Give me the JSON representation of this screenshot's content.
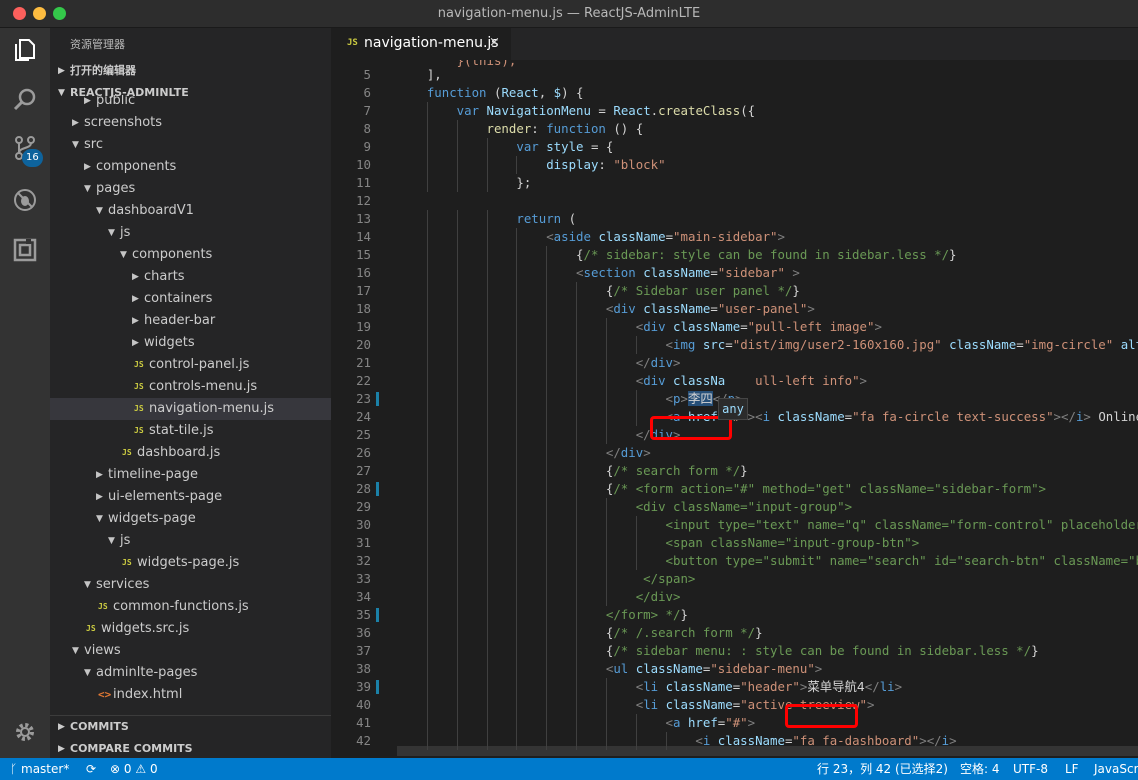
{
  "window": {
    "title": "navigation-menu.js — ReactJS-AdminLTE"
  },
  "activity_bar": {
    "items": [
      {
        "name": "explorer-icon"
      },
      {
        "name": "search-icon"
      },
      {
        "name": "source-control-icon"
      },
      {
        "name": "debug-icon"
      },
      {
        "name": "extensions-icon"
      }
    ],
    "scm_badge": "16"
  },
  "sidebar": {
    "title": "资源管理器",
    "open_editors": "打开的编辑器",
    "project": "REACTJS-ADMINLTE",
    "tree": [
      {
        "label": "public",
        "depth": 2,
        "kind": "folder",
        "expanded": false,
        "partial": true
      },
      {
        "label": "screenshots",
        "depth": 1,
        "kind": "folder",
        "expanded": false
      },
      {
        "label": "src",
        "depth": 1,
        "kind": "folder",
        "expanded": true
      },
      {
        "label": "components",
        "depth": 2,
        "kind": "folder",
        "expanded": false
      },
      {
        "label": "pages",
        "depth": 2,
        "kind": "folder",
        "expanded": true
      },
      {
        "label": "dashboardV1",
        "depth": 3,
        "kind": "folder",
        "expanded": true
      },
      {
        "label": "js",
        "depth": 4,
        "kind": "folder",
        "expanded": true
      },
      {
        "label": "components",
        "depth": 5,
        "kind": "folder",
        "expanded": true
      },
      {
        "label": "charts",
        "depth": 6,
        "kind": "folder",
        "expanded": false
      },
      {
        "label": "containers",
        "depth": 6,
        "kind": "folder",
        "expanded": false
      },
      {
        "label": "header-bar",
        "depth": 6,
        "kind": "folder",
        "expanded": false
      },
      {
        "label": "widgets",
        "depth": 6,
        "kind": "folder",
        "expanded": false
      },
      {
        "label": "control-panel.js",
        "depth": 6,
        "kind": "js"
      },
      {
        "label": "controls-menu.js",
        "depth": 6,
        "kind": "js"
      },
      {
        "label": "navigation-menu.js",
        "depth": 6,
        "kind": "js",
        "selected": true
      },
      {
        "label": "stat-tile.js",
        "depth": 6,
        "kind": "js"
      },
      {
        "label": "dashboard.js",
        "depth": 5,
        "kind": "js"
      },
      {
        "label": "timeline-page",
        "depth": 3,
        "kind": "folder",
        "expanded": false
      },
      {
        "label": "ui-elements-page",
        "depth": 3,
        "kind": "folder",
        "expanded": false
      },
      {
        "label": "widgets-page",
        "depth": 3,
        "kind": "folder",
        "expanded": true
      },
      {
        "label": "js",
        "depth": 4,
        "kind": "folder",
        "expanded": true
      },
      {
        "label": "widgets-page.js",
        "depth": 5,
        "kind": "js"
      },
      {
        "label": "services",
        "depth": 2,
        "kind": "folder",
        "expanded": true
      },
      {
        "label": "common-functions.js",
        "depth": 3,
        "kind": "js"
      },
      {
        "label": "widgets.src.js",
        "depth": 2,
        "kind": "js"
      },
      {
        "label": "views",
        "depth": 1,
        "kind": "folder",
        "expanded": true
      },
      {
        "label": "adminlte-pages",
        "depth": 2,
        "kind": "folder",
        "expanded": true
      },
      {
        "label": "index.html",
        "depth": 3,
        "kind": "html"
      }
    ],
    "sections": [
      {
        "label": "COMMITS"
      },
      {
        "label": "COMPARE COMMITS"
      }
    ],
    "icon_labels": {
      "js": "JS",
      "html": "<>"
    }
  },
  "editor": {
    "tab": {
      "label": "navigation-menu.js",
      "icon": "JS",
      "close": "×"
    },
    "tooltip": "any",
    "lines": [
      {
        "n": 5,
        "indent": 1,
        "modified": false,
        "parts": [
          [
            "p",
            "],"
          ]
        ]
      },
      {
        "n": 6,
        "indent": 1,
        "modified": false,
        "parts": [
          [
            "k",
            "function"
          ],
          [
            "p",
            " ("
          ],
          [
            "a",
            "React"
          ],
          [
            "p",
            ", "
          ],
          [
            "a",
            "$"
          ],
          [
            "p",
            ") {"
          ]
        ]
      },
      {
        "n": 7,
        "indent": 2,
        "modified": false,
        "parts": [
          [
            "k",
            "var"
          ],
          [
            "p",
            " "
          ],
          [
            "a",
            "NavigationMenu"
          ],
          [
            "p",
            " = "
          ],
          [
            "a",
            "React"
          ],
          [
            "p",
            "."
          ],
          [
            "f",
            "createClass"
          ],
          [
            "p",
            "({"
          ]
        ]
      },
      {
        "n": 8,
        "indent": 3,
        "modified": false,
        "parts": [
          [
            "f",
            "render"
          ],
          [
            "p",
            ": "
          ],
          [
            "k",
            "function"
          ],
          [
            "p",
            " () {"
          ]
        ]
      },
      {
        "n": 9,
        "indent": 4,
        "modified": false,
        "parts": [
          [
            "k",
            "var"
          ],
          [
            "p",
            " "
          ],
          [
            "a",
            "style"
          ],
          [
            "p",
            " = {"
          ]
        ]
      },
      {
        "n": 10,
        "indent": 5,
        "modified": false,
        "parts": [
          [
            "a",
            "display"
          ],
          [
            "p",
            ": "
          ],
          [
            "s",
            "\"block\""
          ]
        ]
      },
      {
        "n": 11,
        "indent": 4,
        "modified": false,
        "parts": [
          [
            "p",
            "};"
          ]
        ]
      },
      {
        "n": 12,
        "indent": 0,
        "modified": false,
        "parts": []
      },
      {
        "n": 13,
        "indent": 4,
        "modified": false,
        "parts": [
          [
            "k",
            "return"
          ],
          [
            "p",
            " ("
          ]
        ]
      },
      {
        "n": 14,
        "indent": 5,
        "modified": false,
        "parts": [
          [
            "g",
            "<"
          ],
          [
            "t",
            "aside"
          ],
          [
            "p",
            " "
          ],
          [
            "a",
            "className"
          ],
          [
            "p",
            "="
          ],
          [
            "s",
            "\"main-sidebar\""
          ],
          [
            "g",
            ">"
          ]
        ]
      },
      {
        "n": 15,
        "indent": 6,
        "modified": false,
        "parts": [
          [
            "p",
            "{"
          ],
          [
            "c",
            "/* sidebar: style can be found in sidebar.less */"
          ],
          [
            "p",
            "}"
          ]
        ]
      },
      {
        "n": 16,
        "indent": 6,
        "modified": false,
        "parts": [
          [
            "g",
            "<"
          ],
          [
            "t",
            "section"
          ],
          [
            "p",
            " "
          ],
          [
            "a",
            "className"
          ],
          [
            "p",
            "="
          ],
          [
            "s",
            "\"sidebar\""
          ],
          [
            "p",
            " "
          ],
          [
            "g",
            ">"
          ]
        ]
      },
      {
        "n": 17,
        "indent": 7,
        "modified": false,
        "parts": [
          [
            "p",
            "{"
          ],
          [
            "c",
            "/* Sidebar user panel */"
          ],
          [
            "p",
            "}"
          ]
        ]
      },
      {
        "n": 18,
        "indent": 7,
        "modified": false,
        "parts": [
          [
            "g",
            "<"
          ],
          [
            "t",
            "div"
          ],
          [
            "p",
            " "
          ],
          [
            "a",
            "className"
          ],
          [
            "p",
            "="
          ],
          [
            "s",
            "\"user-panel\""
          ],
          [
            "g",
            ">"
          ]
        ]
      },
      {
        "n": 19,
        "indent": 8,
        "modified": false,
        "parts": [
          [
            "g",
            "<"
          ],
          [
            "t",
            "div"
          ],
          [
            "p",
            " "
          ],
          [
            "a",
            "className"
          ],
          [
            "p",
            "="
          ],
          [
            "s",
            "\"pull-left image\""
          ],
          [
            "g",
            ">"
          ]
        ]
      },
      {
        "n": 20,
        "indent": 9,
        "modified": false,
        "parts": [
          [
            "g",
            "<"
          ],
          [
            "t",
            "img"
          ],
          [
            "p",
            " "
          ],
          [
            "a",
            "src"
          ],
          [
            "p",
            "="
          ],
          [
            "s",
            "\"dist/img/user2-160x160.jpg\""
          ],
          [
            "p",
            " "
          ],
          [
            "a",
            "className"
          ],
          [
            "p",
            "="
          ],
          [
            "s",
            "\"img-circle\""
          ],
          [
            "p",
            " "
          ],
          [
            "a",
            "alt"
          ],
          [
            "p",
            "="
          ],
          [
            "s",
            "\""
          ]
        ]
      },
      {
        "n": 21,
        "indent": 8,
        "modified": false,
        "parts": [
          [
            "g",
            "</"
          ],
          [
            "t",
            "div"
          ],
          [
            "g",
            ">"
          ]
        ]
      },
      {
        "n": 22,
        "indent": 8,
        "modified": false,
        "parts": [
          [
            "g",
            "<"
          ],
          [
            "t",
            "div"
          ],
          [
            "p",
            " "
          ],
          [
            "a",
            "classNa"
          ],
          [
            "p",
            "    "
          ],
          [
            "s",
            "ull-left info\""
          ],
          [
            "g",
            ">"
          ]
        ]
      },
      {
        "n": 23,
        "indent": 9,
        "modified": true,
        "parts": [
          [
            "g",
            "<"
          ],
          [
            "t",
            "p"
          ],
          [
            "g",
            ">"
          ],
          [
            "cjk",
            "李四"
          ],
          [
            "g",
            "</"
          ],
          [
            "t",
            "p"
          ],
          [
            "g",
            ">"
          ]
        ]
      },
      {
        "n": 24,
        "indent": 9,
        "modified": false,
        "parts": [
          [
            "g",
            "<"
          ],
          [
            "t",
            "a"
          ],
          [
            "p",
            " "
          ],
          [
            "a",
            "href"
          ],
          [
            "p",
            "="
          ],
          [
            "s",
            "\"#\""
          ],
          [
            "g",
            "><"
          ],
          [
            "t",
            "i"
          ],
          [
            "p",
            " "
          ],
          [
            "a",
            "className"
          ],
          [
            "p",
            "="
          ],
          [
            "s",
            "\"fa fa-circle text-success\""
          ],
          [
            "g",
            "></"
          ],
          [
            "t",
            "i"
          ],
          [
            "g",
            ">"
          ],
          [
            "p",
            " Online"
          ],
          [
            "g",
            "</"
          ]
        ]
      },
      {
        "n": 25,
        "indent": 8,
        "modified": false,
        "parts": [
          [
            "g",
            "</"
          ],
          [
            "t",
            "div"
          ],
          [
            "g",
            ">"
          ]
        ]
      },
      {
        "n": 26,
        "indent": 7,
        "modified": false,
        "parts": [
          [
            "g",
            "</"
          ],
          [
            "t",
            "div"
          ],
          [
            "g",
            ">"
          ]
        ]
      },
      {
        "n": 27,
        "indent": 7,
        "modified": false,
        "parts": [
          [
            "p",
            "{"
          ],
          [
            "c",
            "/* search form */"
          ],
          [
            "p",
            "}"
          ]
        ]
      },
      {
        "n": 28,
        "indent": 7,
        "modified": true,
        "parts": [
          [
            "p",
            "{"
          ],
          [
            "c",
            "/* <form action=\"#\" method=\"get\" className=\"sidebar-form\">"
          ]
        ]
      },
      {
        "n": 29,
        "indent": 8,
        "modified": false,
        "parts": [
          [
            "c",
            "<div className=\"input-group\">"
          ]
        ]
      },
      {
        "n": 30,
        "indent": 9,
        "modified": false,
        "parts": [
          [
            "c",
            "<input type=\"text\" name=\"q\" className=\"form-control\" placeholder=\""
          ]
        ]
      },
      {
        "n": 31,
        "indent": 9,
        "modified": false,
        "parts": [
          [
            "c",
            "<span className=\"input-group-btn\">"
          ]
        ]
      },
      {
        "n": 32,
        "indent": 9,
        "modified": false,
        "parts": [
          [
            "c",
            "<button type=\"submit\" name=\"search\" id=\"search-btn\" className=\"btn"
          ]
        ]
      },
      {
        "n": 33,
        "indent": 8,
        "modified": false,
        "parts": [
          [
            "c",
            " </span>"
          ]
        ]
      },
      {
        "n": 34,
        "indent": 8,
        "modified": false,
        "parts": [
          [
            "c",
            "</div>"
          ]
        ]
      },
      {
        "n": 35,
        "indent": 7,
        "modified": true,
        "parts": [
          [
            "c",
            "</form> */"
          ],
          [
            "p",
            "}"
          ]
        ]
      },
      {
        "n": 36,
        "indent": 7,
        "modified": false,
        "parts": [
          [
            "p",
            "{"
          ],
          [
            "c",
            "/* /.search form */"
          ],
          [
            "p",
            "}"
          ]
        ]
      },
      {
        "n": 37,
        "indent": 7,
        "modified": false,
        "parts": [
          [
            "p",
            "{"
          ],
          [
            "c",
            "/* sidebar menu: : style can be found in sidebar.less */"
          ],
          [
            "p",
            "}"
          ]
        ]
      },
      {
        "n": 38,
        "indent": 7,
        "modified": false,
        "parts": [
          [
            "g",
            "<"
          ],
          [
            "t",
            "ul"
          ],
          [
            "p",
            " "
          ],
          [
            "a",
            "className"
          ],
          [
            "p",
            "="
          ],
          [
            "s",
            "\"sidebar-menu\""
          ],
          [
            "g",
            ">"
          ]
        ]
      },
      {
        "n": 39,
        "indent": 8,
        "modified": true,
        "parts": [
          [
            "g",
            "<"
          ],
          [
            "t",
            "li"
          ],
          [
            "p",
            " "
          ],
          [
            "a",
            "className"
          ],
          [
            "p",
            "="
          ],
          [
            "s",
            "\"header\""
          ],
          [
            "g",
            ">"
          ],
          [
            "cjk",
            "菜单导航4"
          ],
          [
            "g",
            "</"
          ],
          [
            "t",
            "li"
          ],
          [
            "g",
            ">"
          ]
        ]
      },
      {
        "n": 40,
        "indent": 8,
        "modified": false,
        "parts": [
          [
            "g",
            "<"
          ],
          [
            "t",
            "li"
          ],
          [
            "p",
            " "
          ],
          [
            "a",
            "className"
          ],
          [
            "p",
            "="
          ],
          [
            "s",
            "\"active treeview\""
          ],
          [
            "g",
            ">"
          ]
        ]
      },
      {
        "n": 41,
        "indent": 9,
        "modified": false,
        "parts": [
          [
            "g",
            "<"
          ],
          [
            "t",
            "a"
          ],
          [
            "p",
            " "
          ],
          [
            "a",
            "href"
          ],
          [
            "p",
            "="
          ],
          [
            "s",
            "\"#\""
          ],
          [
            "g",
            ">"
          ]
        ]
      },
      {
        "n": 42,
        "indent": 10,
        "modified": false,
        "parts": [
          [
            "g",
            "<"
          ],
          [
            "t",
            "i"
          ],
          [
            "p",
            " "
          ],
          [
            "a",
            "className"
          ],
          [
            "p",
            "="
          ],
          [
            "s",
            "\"fa fa-dashboard\""
          ],
          [
            "g",
            "></"
          ],
          [
            "t",
            "i"
          ],
          [
            "g",
            ">"
          ]
        ]
      }
    ],
    "partial_top_line": "}(this);"
  },
  "statusbar": {
    "branch": "master*",
    "errors": "0",
    "warnings": "0",
    "position": "行 23，列 42 (已选择2)",
    "spaces": "空格: 4",
    "encoding": "UTF-8",
    "eol": "LF",
    "language": "JavaScript"
  },
  "colors": {
    "accent": "#007acc",
    "annotation_box": "#ff0000"
  }
}
